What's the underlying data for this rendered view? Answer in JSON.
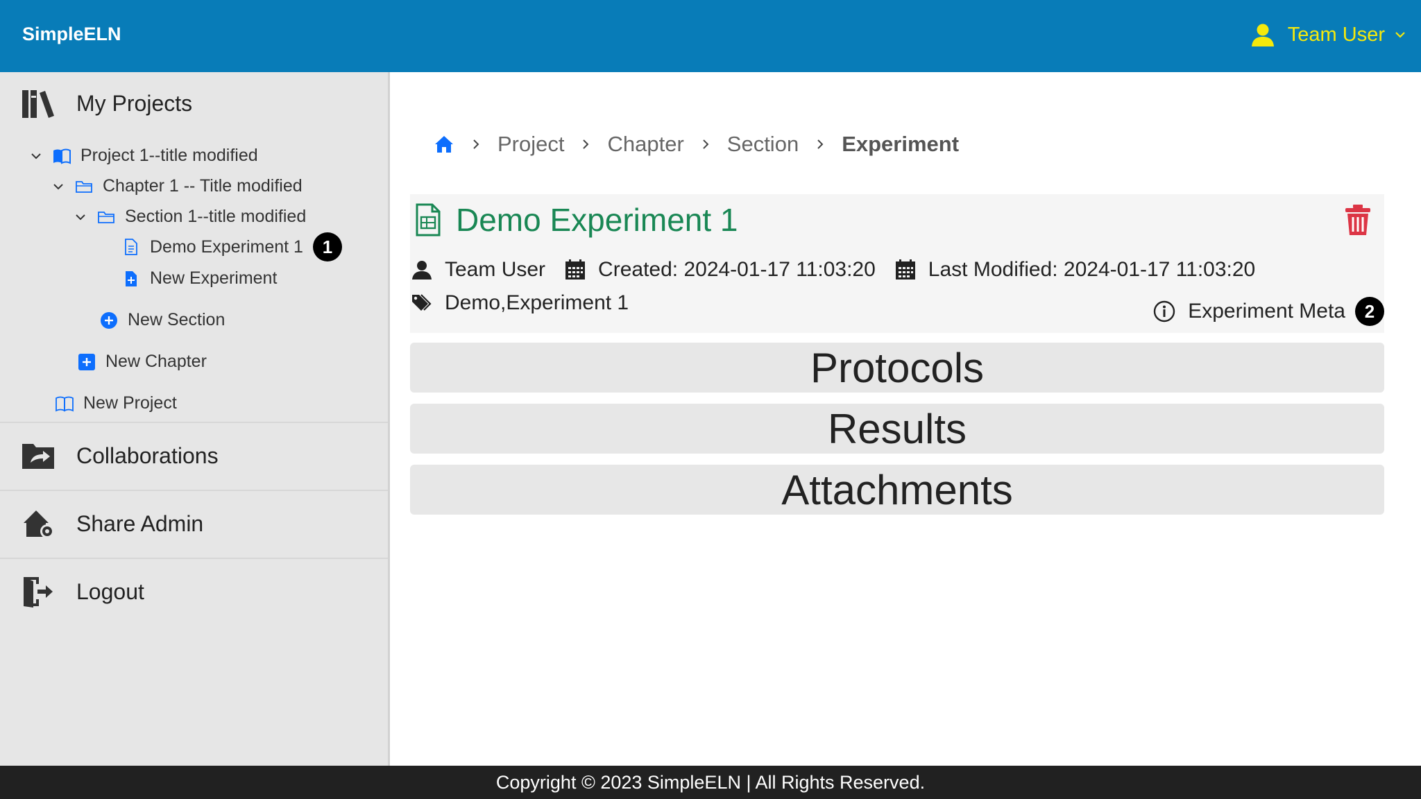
{
  "app": {
    "brand": "SimpleELN"
  },
  "user_menu": {
    "name": "Team User",
    "accent_color": "#f5e90c"
  },
  "sidebar": {
    "my_projects": "My Projects",
    "tree": {
      "project": "Project 1--title modified",
      "chapter": "Chapter 1 -- Title modified",
      "section": "Section 1--title modified",
      "experiment": "Demo Experiment 1",
      "experiment_badge": "1",
      "new_experiment": "New Experiment",
      "new_section": "New Section",
      "new_chapter": "New Chapter",
      "new_project": "New Project"
    },
    "collaborations": "Collaborations",
    "share_admin": "Share Admin",
    "logout": "Logout"
  },
  "breadcrumb": {
    "items": [
      "Project",
      "Chapter",
      "Section"
    ],
    "current": "Experiment"
  },
  "experiment": {
    "title": "Demo Experiment 1",
    "title_color": "#198754",
    "owner": "Team User",
    "created": "Created: 2024-01-17 11:03:20",
    "last_modified": "Last Modified: 2024-01-17 11:03:20",
    "tags": "Demo,Experiment 1",
    "meta_label": "Experiment Meta",
    "meta_badge": "2",
    "delete_color": "#dc3545"
  },
  "sections": {
    "protocols": "Protocols",
    "results": "Results",
    "attachments": "Attachments"
  },
  "footer": {
    "text": "Copyright © 2023 SimpleELN | All Rights Reserved."
  },
  "colors": {
    "header": "#087cb8",
    "link_blue": "#0d6efd"
  }
}
